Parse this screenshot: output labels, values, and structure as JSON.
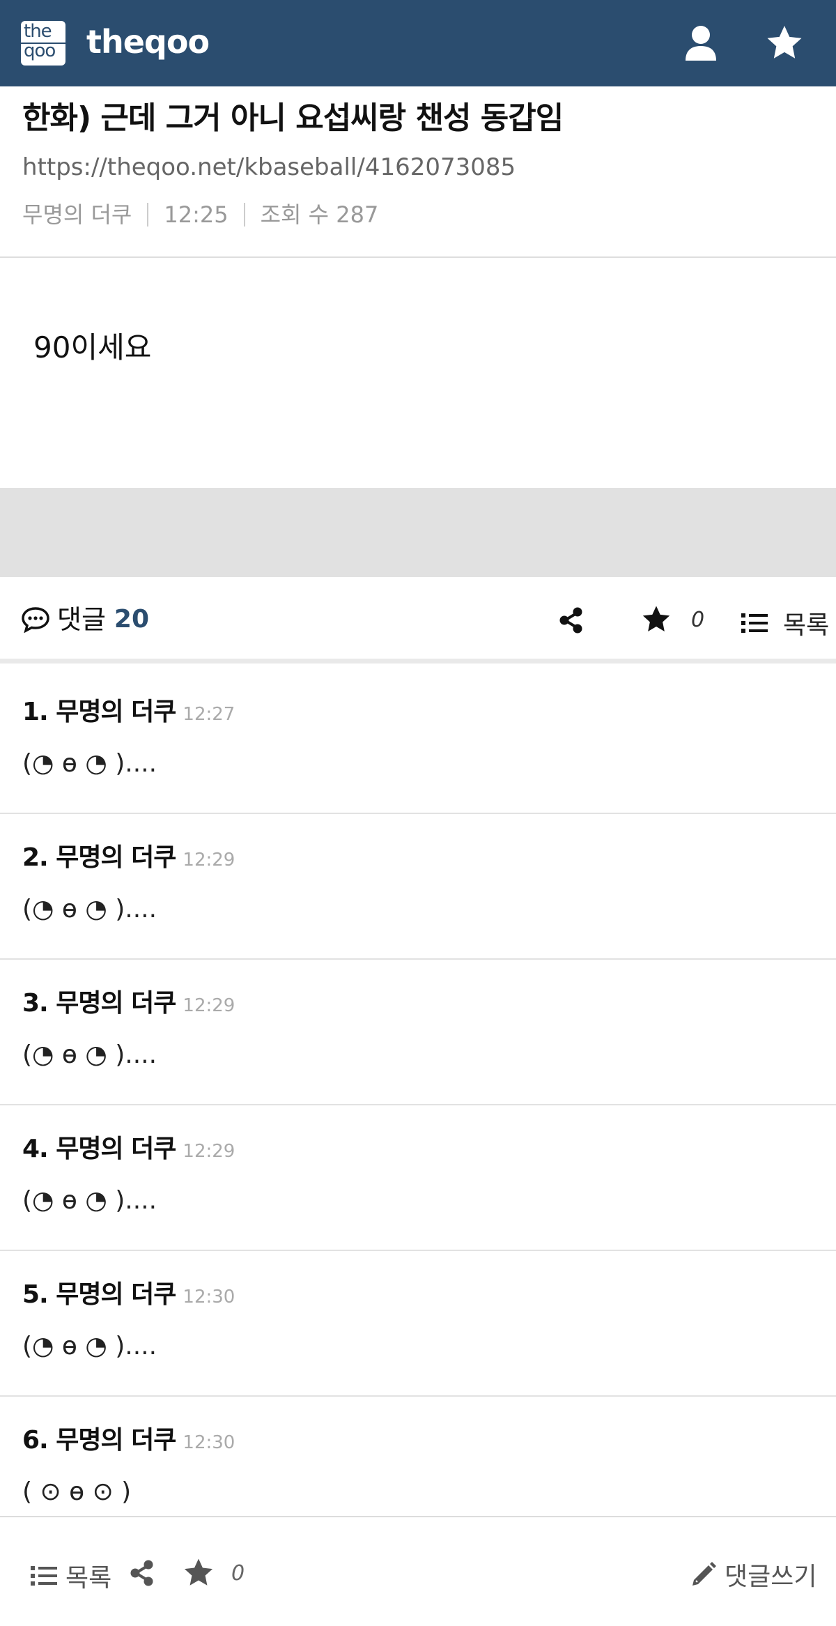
{
  "header": {
    "logo_line1": "the",
    "logo_line2": "qoo",
    "brand": "theqoo",
    "user_icon": "user-icon",
    "star_icon": "star-icon",
    "color": "#2b4d6f"
  },
  "post": {
    "title": "한화) 근데 그거 아니 요섭씨랑 챈성 동갑임",
    "url": "https://theqoo.net/kbaseball/4162073085",
    "author": "무명의 더쿠",
    "time": "12:25",
    "views": "조회 수 287",
    "body": "90이세요"
  },
  "actions": {
    "comment_label": "댓글",
    "comment_count": "20",
    "share_icon": "share-icon",
    "star_count": "0",
    "list_label": "목록"
  },
  "comments": [
    {
      "no_name": "1. 무명의 더쿠",
      "time": "12:27",
      "text": "(◔ ɵ ◔ )...."
    },
    {
      "no_name": "2. 무명의 더쿠",
      "time": "12:29",
      "text": "(◔ ɵ ◔ )...."
    },
    {
      "no_name": "3. 무명의 더쿠",
      "time": "12:29",
      "text": "(◔ ɵ ◔ )...."
    },
    {
      "no_name": "4. 무명의 더쿠",
      "time": "12:29",
      "text": "(◔ ɵ ◔ )...."
    },
    {
      "no_name": "5. 무명의 더쿠",
      "time": "12:30",
      "text": "(◔ ɵ ◔ )...."
    },
    {
      "no_name": "6. 무명의 더쿠",
      "time": "12:30",
      "text": "( ⊙ ɵ ⊙ )"
    }
  ],
  "bottom": {
    "list_label": "목록",
    "star_count": "0",
    "write_label": "댓글쓰기"
  }
}
